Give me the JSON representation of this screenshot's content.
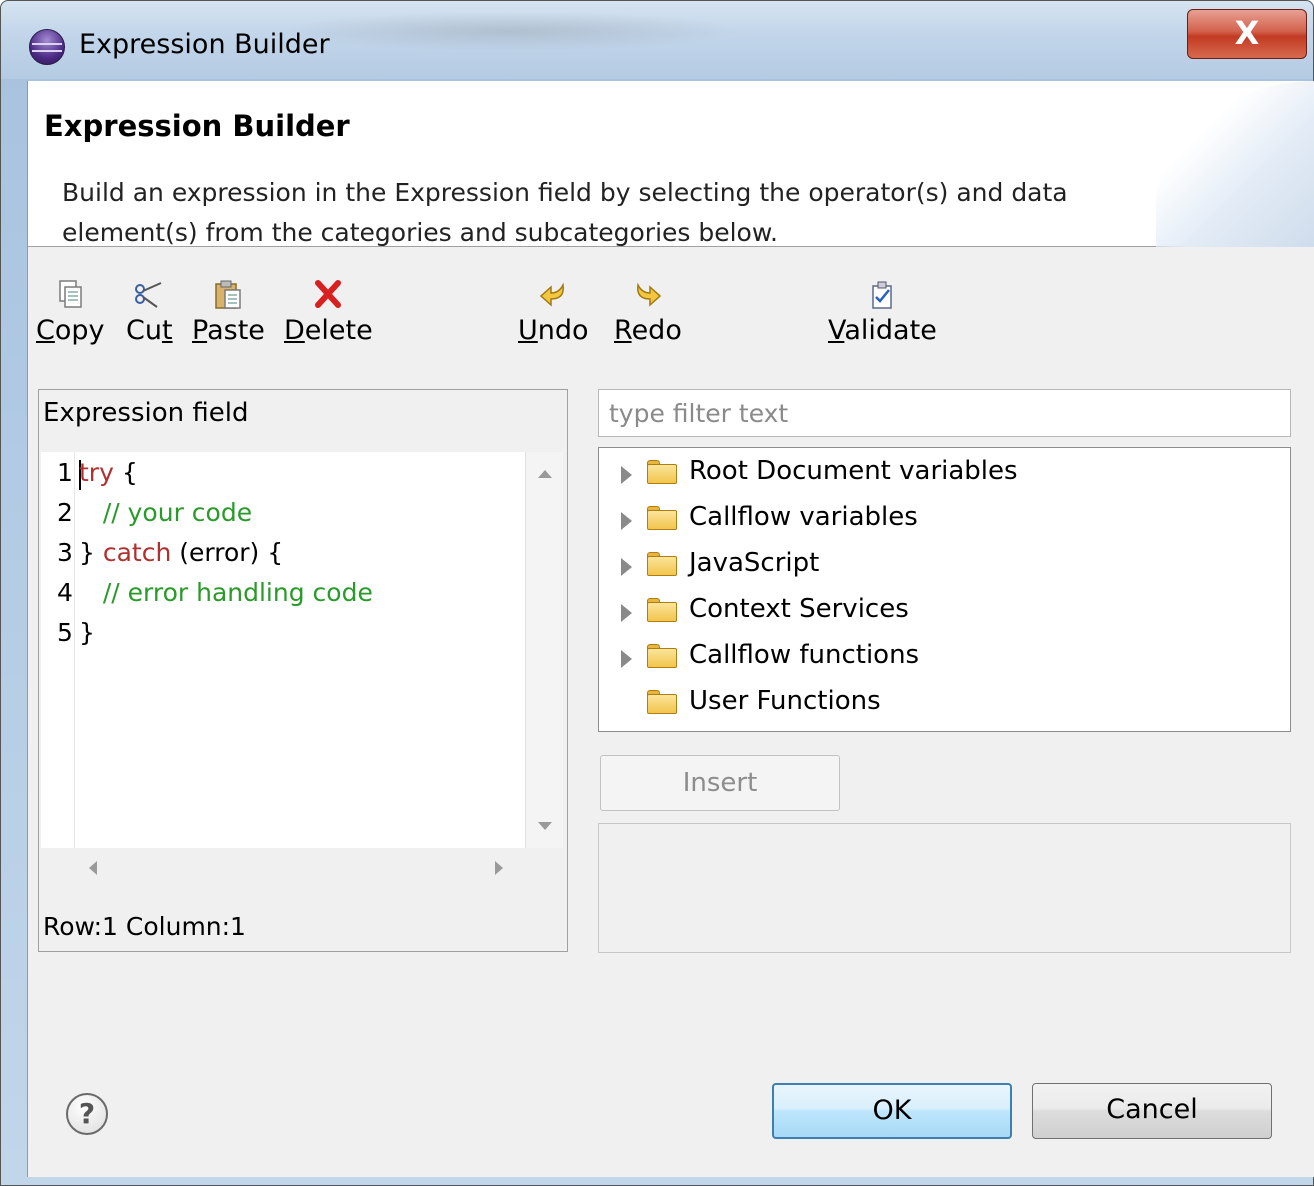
{
  "window": {
    "title": "Expression Builder",
    "close_glyph": "X",
    "accent_color": "#c23a23"
  },
  "header": {
    "title": "Expression Builder",
    "description": "Build an expression in the Expression field by selecting the operator(s) and data element(s) from the categories and subcategories below."
  },
  "toolbar": {
    "copy": {
      "mnemonic": "C",
      "rest": "opy",
      "icon": "copy-icon"
    },
    "cut": {
      "pre": "Cu",
      "mnemonic": "t",
      "icon": "scissors-icon"
    },
    "paste": {
      "mnemonic": "P",
      "rest": "aste",
      "icon": "paste-icon"
    },
    "delete": {
      "mnemonic": "D",
      "rest": "elete",
      "icon": "delete-icon"
    },
    "undo": {
      "mnemonic": "U",
      "rest": "ndo",
      "icon": "undo-icon"
    },
    "redo": {
      "mnemonic": "R",
      "rest": "edo",
      "icon": "redo-icon"
    },
    "validate": {
      "mnemonic": "V",
      "rest": "alidate",
      "icon": "validate-icon"
    }
  },
  "expression": {
    "legend": "Expression field",
    "line_numbers": [
      "1",
      "2",
      "3",
      "4",
      "5"
    ],
    "lines": [
      {
        "kw": "try",
        "rest": " {"
      },
      {
        "indent": "   ",
        "comment": "// your code"
      },
      {
        "pre": "} ",
        "kw": "catch",
        "rest": " (error) {"
      },
      {
        "indent": "   ",
        "comment": "// error handling code"
      },
      {
        "pre": "}"
      }
    ],
    "status": "Row:1 Column:1"
  },
  "filter": {
    "placeholder": "type filter text",
    "value": ""
  },
  "tree": {
    "items": [
      {
        "label": "Root Document variables",
        "expandable": true
      },
      {
        "label": "Callflow variables",
        "expandable": true
      },
      {
        "label": "JavaScript",
        "expandable": true
      },
      {
        "label": "Context Services",
        "expandable": true
      },
      {
        "label": "Callflow functions",
        "expandable": true
      },
      {
        "label": "User Functions",
        "expandable": false
      }
    ]
  },
  "insert_button": {
    "label": "Insert",
    "enabled": false
  },
  "help": {
    "glyph": "?"
  },
  "buttons": {
    "ok": "OK",
    "cancel": "Cancel"
  }
}
